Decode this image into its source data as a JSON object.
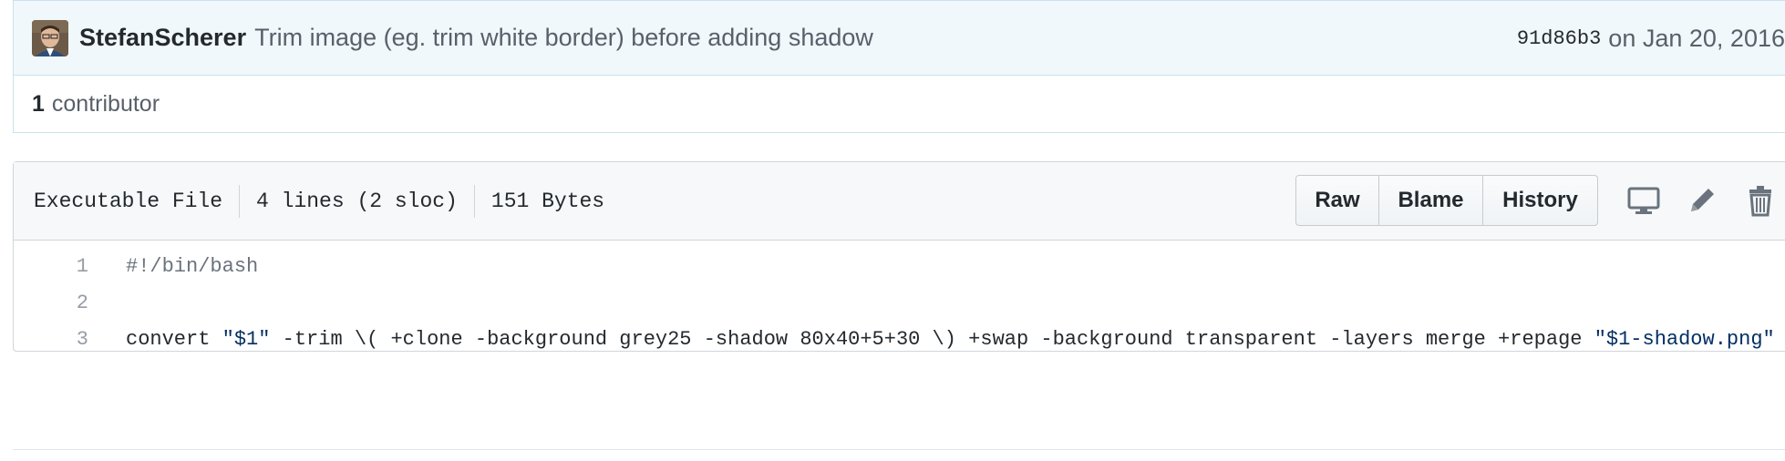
{
  "commit": {
    "author": "StefanScherer",
    "message": "Trim image (eg. trim white border) before adding shadow",
    "sha": "91d86b3",
    "date_prefix": "on",
    "date": "Jan 20, 2016"
  },
  "contributors": {
    "count": "1",
    "label": "contributor"
  },
  "file": {
    "type": "Executable File",
    "lines": "4 lines (2 sloc)",
    "size": "151 Bytes",
    "buttons": {
      "raw": "Raw",
      "blame": "Blame",
      "history": "History"
    },
    "icons": [
      "desktop-icon",
      "pencil-icon",
      "trash-icon"
    ]
  },
  "code": {
    "lines": [
      {
        "num": "1",
        "text": "#!/bin/bash"
      },
      {
        "num": "2",
        "text": ""
      },
      {
        "num": "3",
        "text": "convert \"$1\" -trim \\( +clone -background grey25 -shadow 80x40+5+30 \\) +swap -background transparent -layers merge +repage \"$1-shadow.png\""
      }
    ],
    "line3_parts": {
      "a": "convert ",
      "s1": "\"$1\"",
      "b": " -trim \\( +clone -background grey25 -shadow 80x40+5+30 \\) +swap -background transparent -layers merge +repage ",
      "s2": "\"$1",
      "s3": "-shadow.png\""
    }
  },
  "colors": {
    "commit_bg": "#f1f8fc",
    "border": "#c9e1ee",
    "string": "#032f62",
    "muted": "#586069"
  }
}
